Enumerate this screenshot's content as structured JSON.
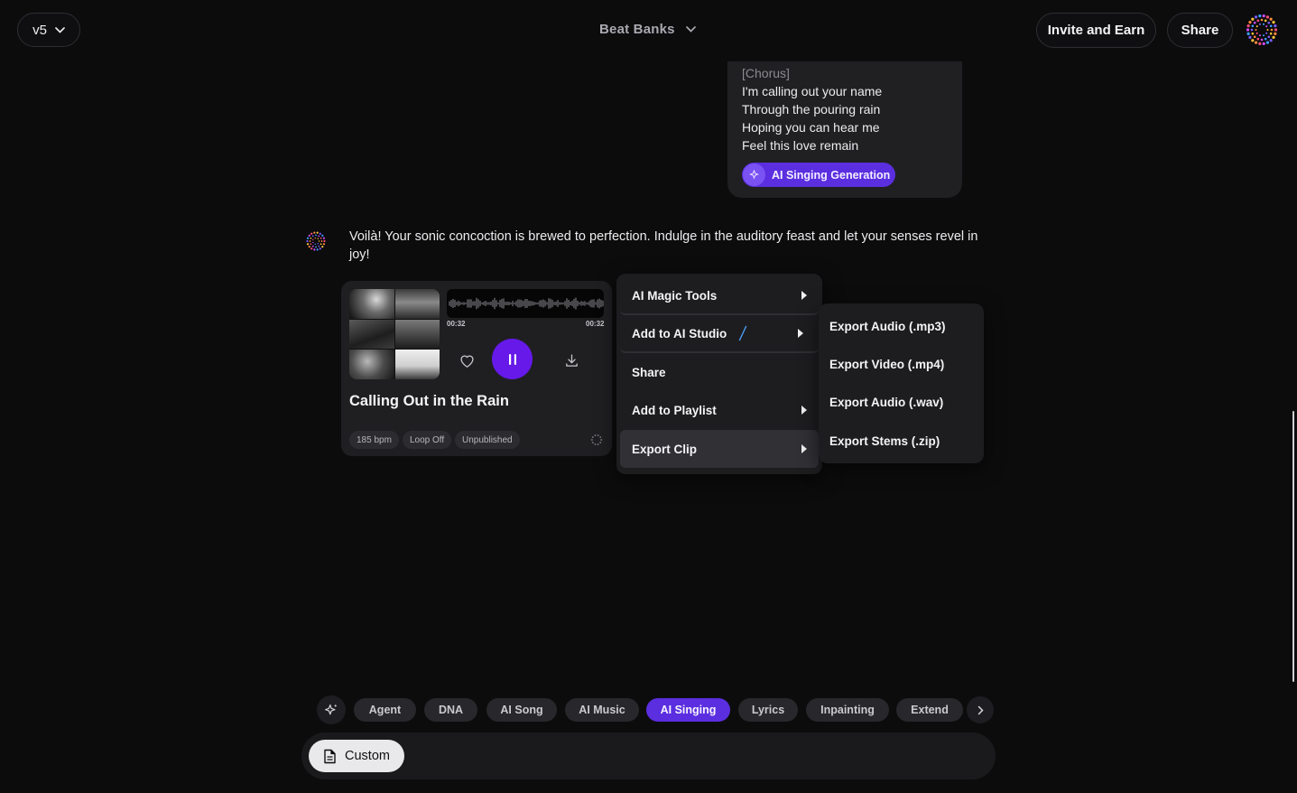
{
  "header": {
    "version_label": "v5",
    "project_title": "Beat Banks",
    "invite_label": "Invite and Earn",
    "share_label": "Share",
    "logo_icon": "dotted-circle-logo-icon"
  },
  "lyrics_card": {
    "lines": [
      "[Chorus]",
      "I'm calling out your name",
      "Through the pouring rain",
      "Hoping you can hear me",
      "Feel this love remain"
    ],
    "badge_label": "AI Singing Generation"
  },
  "assistant": {
    "message": "Voilà! Your sonic concoction is brewed to perfection. Indulge in the auditory feast and let your senses revel in joy!"
  },
  "song": {
    "title": "Calling Out in the Rain",
    "time_elapsed": "00:32",
    "time_total": "00:32",
    "tags": [
      "185 bpm",
      "Loop Off",
      "Unpublished"
    ],
    "is_playing": true
  },
  "context_menu": {
    "items": [
      {
        "label": "AI Magic Tools",
        "has_submenu": true
      },
      {
        "label": "Add to AI Studio",
        "has_submenu": true
      },
      {
        "label": "Share",
        "has_submenu": false
      },
      {
        "label": "Add to Playlist",
        "has_submenu": true
      },
      {
        "label": "Export Clip",
        "has_submenu": true,
        "active": true
      }
    ]
  },
  "export_submenu": {
    "items": [
      "Export Audio (.mp3)",
      "Export Video (.mp4)",
      "Export Audio (.wav)",
      "Export Stems (.zip)"
    ]
  },
  "modes": {
    "items": [
      "Agent",
      "DNA",
      "AI Song",
      "AI Music",
      "AI Singing",
      "Lyrics",
      "Inpainting",
      "Extend"
    ],
    "active": "AI Singing"
  },
  "composer": {
    "custom_label": "Custom"
  },
  "colors": {
    "accent": "#5b2ee0",
    "play": "#6619e8",
    "background": "#0c0c0d"
  }
}
